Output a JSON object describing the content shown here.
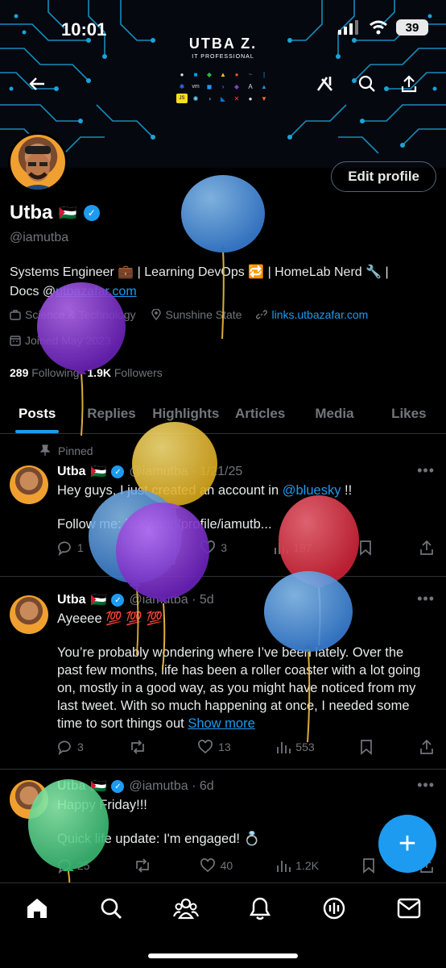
{
  "status": {
    "time": "10:01",
    "battery": "39"
  },
  "banner": {
    "brand_name": "UTBA Z.",
    "brand_sub": "IT PROFESSIONAL",
    "tech_icons": [
      "apple-icon",
      "windows-icon",
      "nginx-icon",
      "linux-icon",
      "ubuntu-icon",
      "kali-icon",
      "cisco-icon",
      "kubernetes-icon",
      "vmware-icon",
      "docker-icon",
      "powershell-icon",
      "terraform-icon",
      "ansible-icon",
      "arch-icon",
      "javascript-icon",
      "react-icon",
      "python-icon",
      "vscode-icon",
      "git-icon",
      "github-icon",
      "gitlab-icon"
    ]
  },
  "profile": {
    "name": "Utba",
    "flag": "🇵🇸",
    "handle": "@iamutba",
    "edit_label": "Edit profile",
    "bio_line1": "Systems Engineer 💼 | Learning DevOps 🔁 | HomeLab Nerd 🔧 |",
    "bio_docs": "Docs @",
    "bio_link": "utbazafar.com",
    "category": "Science & Technology",
    "location": "Sunshine State",
    "website": "links.utbazafar.com",
    "joined": "Joined May 2023",
    "following_count": "289",
    "following_label": "Following",
    "followers_count": "1.9K",
    "followers_label": "Followers"
  },
  "tabs": [
    "Posts",
    "Replies",
    "Highlights",
    "Articles",
    "Media",
    "Likes"
  ],
  "posts": [
    {
      "pinned_label": "Pinned",
      "name": "Utba",
      "flag": "🇵🇸",
      "meta": "@iamutba · 1/21/25",
      "text1": "Hey guys, I just created an account in ",
      "mention": "@bluesky",
      "text1_end": " !!",
      "text2": "Follow me: bsky.app/profile/iamutb...",
      "replies": "1",
      "reposts": "",
      "likes": "3",
      "views": "187"
    },
    {
      "name": "Utba",
      "flag": "🇵🇸",
      "meta": "@iamutba · 5d",
      "text1": "Ayeeee 💯 💯 💯",
      "text2": "You’re probably wondering where I’ve been lately. Over the past few months, life has been a roller coaster with a lot going on, mostly in a good way, as you might have noticed from my last tweet. With so much happening at once, I needed some time to sort things out ",
      "show_more": "Show more",
      "replies": "3",
      "reposts": "",
      "likes": "13",
      "views": "553"
    },
    {
      "name": "Utba",
      "flag": "🇵🇸",
      "meta": "@iamutba · 6d",
      "text1": "Happy Friday!!!",
      "text2": "Quick life update: I'm engaged! 💍",
      "replies": "25",
      "reposts": "",
      "likes": "40",
      "views": "1.2K"
    }
  ],
  "fab_label": "+",
  "colors": {
    "accent": "#1d9bf0",
    "background": "#000000",
    "muted": "#71767b"
  }
}
